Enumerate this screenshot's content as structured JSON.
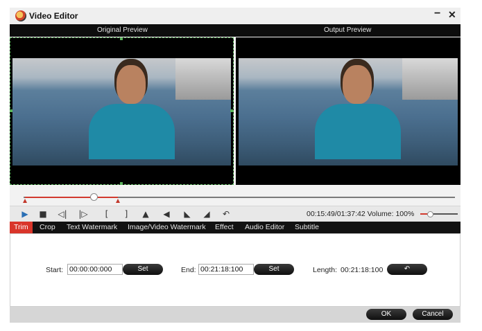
{
  "window": {
    "title": "Video Editor",
    "minimize": "−",
    "close": "✕"
  },
  "preview": {
    "original_label": "Original Preview",
    "output_label": "Output Preview"
  },
  "playback": {
    "time": "00:15:49/01:37:42",
    "volume_label": "Volume:",
    "volume_value": "100%",
    "volume_level": 0.25,
    "position_fraction": 0.16
  },
  "controls": [
    {
      "name": "play-icon",
      "glyph": "▶"
    },
    {
      "name": "stop-icon",
      "glyph": "■"
    },
    {
      "name": "prev-frame-icon",
      "glyph": "◁|"
    },
    {
      "name": "next-frame-icon",
      "glyph": "|▷"
    },
    {
      "name": "set-start-icon",
      "glyph": "["
    },
    {
      "name": "set-end-icon",
      "glyph": "]"
    },
    {
      "name": "flip-horizontal-icon",
      "glyph": "▲"
    },
    {
      "name": "flip-vertical-icon",
      "glyph": "◀"
    },
    {
      "name": "rotate-left-icon",
      "glyph": "◣"
    },
    {
      "name": "rotate-right-icon",
      "glyph": "◢"
    },
    {
      "name": "reset-icon",
      "glyph": "↶"
    }
  ],
  "tabs": [
    "Trim",
    "Crop",
    "Text Watermark",
    "Image/Video Watermark",
    "Effect",
    "Audio Editor",
    "Subtitle"
  ],
  "trim": {
    "start_label": "Start:",
    "start_value": "00:00:00:000",
    "end_label": "End:",
    "end_value": "00:21:18:100",
    "length_label": "Length:",
    "length_value": "00:21:18:100",
    "set_label": "Set",
    "reset_glyph": "↶"
  },
  "footer": {
    "ok": "OK",
    "cancel": "Cancel"
  },
  "colors": {
    "accent": "#d9352a",
    "header": "#0d0d0d",
    "tabbar": "#121212"
  }
}
